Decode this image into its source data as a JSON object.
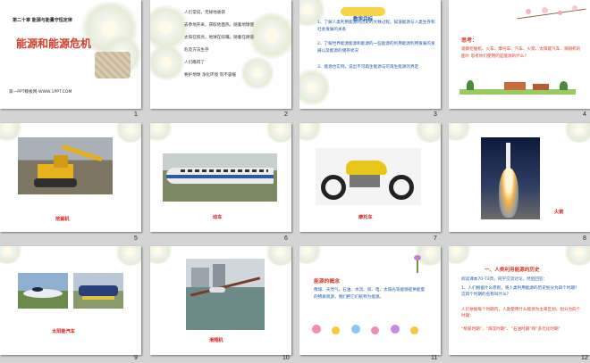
{
  "slides": [
    {
      "number": "1",
      "chapter": "第二十章 能源与能量守恒定律",
      "title": "能源和能源危机",
      "footer": "第一PPT模板网-WWW.1PPT.COM"
    },
    {
      "number": "2",
      "lines": [
        "人们常说，无秘地收获",
        "去参地开采，获取地面热。随着地球使",
        "太阳在照亮，地球在喧嚷。随着在耕道",
        "危及方法生存",
        "人们瞧得了",
        "要护地球 净化环境 刻不容缓"
      ]
    },
    {
      "number": "3",
      "heading": "教学目标",
      "items": [
        "1、了解人类利用能源的历史的大致过程。知道能源与人类生存和社会发展的关系",
        "2、了解世界能源能源和能源的一些能源的利用能源利用发展的发展以及能源的储存状况",
        "3、能源合实例，说出不可再生能源与可再生能源的界定"
      ]
    },
    {
      "number": "4",
      "label": "思考：",
      "text": "观察挖掘机、火车、摩托车、汽车、火箭、太阳能汽车、滑翔机的图片 思考你们使用的是能源的什么？"
    },
    {
      "number": "5",
      "caption": "挖掘机"
    },
    {
      "number": "6",
      "caption": "动车"
    },
    {
      "number": "7",
      "caption": "摩托车"
    },
    {
      "number": "8",
      "caption": "火箭"
    },
    {
      "number": "9",
      "caption": "太阳能汽车"
    },
    {
      "number": "10",
      "caption": "滑翔机"
    },
    {
      "number": "11",
      "heading": "能源的概念",
      "text": "像煤、天然气、石油、水流、风、电、太阳光等能够提供能量的物质资源，我们把它们统称为能源。"
    },
    {
      "number": "12",
      "heading": "一、人类利用能源的历史",
      "lines": [
        "阅读课本70-73页，同学交流讨论，然后回答：",
        "1、人们根据什么原则，将人类利用能源的历史划分为四个时期？这四个时期的名称叫什么？",
        "人们依据每个时期内，人类使用什么能源为主来区划，划分为四个时期：",
        ""
      ],
      "eras": "“柴薪时期”、“煤炭时期”、“石油时期”和“多元化时期”"
    }
  ],
  "colors": {
    "title_red": "#d63a2a",
    "text_blue": "#1b5aa8",
    "caption_red": "#d82020"
  }
}
